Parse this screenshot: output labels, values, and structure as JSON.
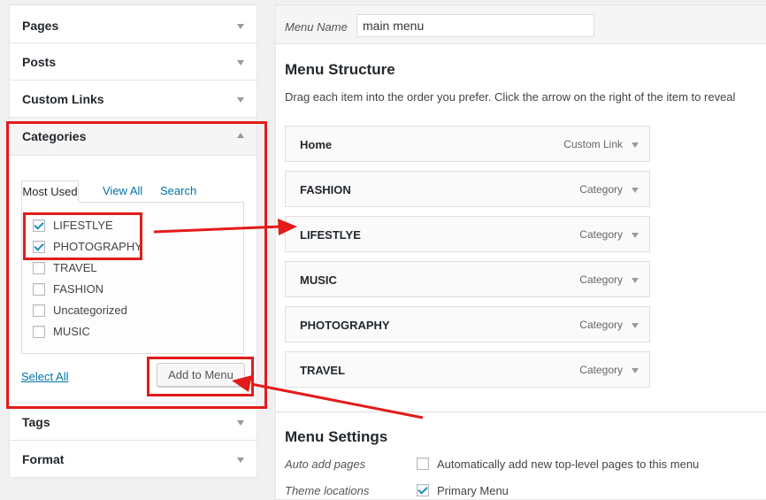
{
  "left_panel": {
    "sections_top": [
      {
        "label": "Pages"
      },
      {
        "label": "Posts"
      },
      {
        "label": "Custom Links"
      }
    ],
    "open_section": {
      "label": "Categories",
      "tabs": [
        "Most Used",
        "View All",
        "Search"
      ],
      "active_tab": "Most Used",
      "items": [
        {
          "label": "LIFESTLYE",
          "checked": true
        },
        {
          "label": "PHOTOGRAPHY",
          "checked": true
        },
        {
          "label": "TRAVEL",
          "checked": false
        },
        {
          "label": "FASHION",
          "checked": false
        },
        {
          "label": "Uncategorized",
          "checked": false
        },
        {
          "label": "MUSIC",
          "checked": false
        }
      ],
      "select_all": "Select All",
      "add_button": "Add to Menu"
    },
    "sections_bottom": [
      {
        "label": "Tags"
      },
      {
        "label": "Format"
      }
    ]
  },
  "right_panel": {
    "menu_name_label": "Menu Name",
    "menu_name_value": "main menu",
    "structure_heading": "Menu Structure",
    "structure_desc": "Drag each item into the order you prefer. Click the arrow on the right of the item to reveal",
    "menu_items": [
      {
        "title": "Home",
        "type": "Custom Link"
      },
      {
        "title": "FASHION",
        "type": "Category"
      },
      {
        "title": "LIFESTLYE",
        "type": "Category"
      },
      {
        "title": "MUSIC",
        "type": "Category"
      },
      {
        "title": "PHOTOGRAPHY",
        "type": "Category"
      },
      {
        "title": "TRAVEL",
        "type": "Category"
      }
    ],
    "settings_heading": "Menu Settings",
    "auto_add_label": "Auto add pages",
    "auto_add_text": "Automatically add new top-level pages to this menu",
    "theme_locations_label": "Theme locations",
    "primary_menu_text": "Primary Menu"
  },
  "colors": {
    "annotation": "#e31b1b",
    "link": "#0073aa",
    "checkmark": "#1e8cbe"
  }
}
